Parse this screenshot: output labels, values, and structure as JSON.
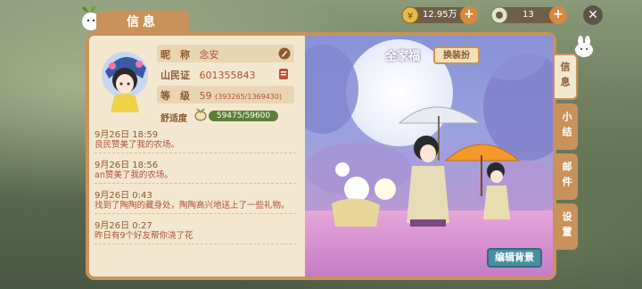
{
  "header": {
    "title": "信息"
  },
  "currency": {
    "coins": "12.95万",
    "jade": "13"
  },
  "profile": {
    "nickname_label": "昵　称",
    "nickname": "念安",
    "id_label": "山民证",
    "id": "601355843",
    "level_label": "等　级",
    "level": "59",
    "exp": "(393265/1369430)",
    "comfort_label": "舒适度",
    "comfort": "59475/59600"
  },
  "log": [
    {
      "date": "9月26日 18:59",
      "text": "良民赞美了我的农场。"
    },
    {
      "date": "9月26日 18:56",
      "text": "an赞美了我的农场。"
    },
    {
      "date": "9月26日 0:43",
      "text": "找到了陶陶的藏身处，陶陶高兴地送上了一些礼物。"
    },
    {
      "date": "9月26日 0:27",
      "text": "昨日有9个好友帮你浇了花"
    }
  ],
  "scene": {
    "family_label": "全家福",
    "outfit_button": "换装扮",
    "edit_button": "编辑背景"
  },
  "side_tabs": [
    "信息",
    "小结",
    "邮件",
    "设置"
  ],
  "colors": {
    "accent": "#c8925a",
    "panel": "#f3e7cf",
    "text_red": "#b0503a"
  }
}
